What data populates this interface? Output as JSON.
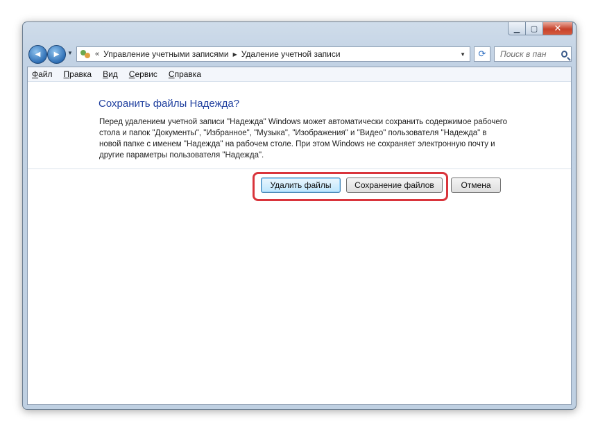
{
  "window": {
    "caption_buttons": {
      "minimize": "▁",
      "maximize": "▢",
      "close": "✕"
    }
  },
  "navbar": {
    "back_glyph": "◀",
    "forward_glyph": "▶",
    "history_glyph": "▼",
    "address": {
      "sep": "«",
      "crumbs": [
        "Управление учетными записями",
        "Удаление учетной записи"
      ],
      "crumb_arrow": "▶",
      "dropdown_glyph": "▼"
    },
    "refresh_glyph": "⟳",
    "search": {
      "placeholder": "Поиск в пан"
    }
  },
  "menubar": {
    "items": [
      {
        "accel": "Ф",
        "rest": "айл"
      },
      {
        "accel": "П",
        "rest": "равка"
      },
      {
        "accel": "В",
        "rest": "ид"
      },
      {
        "accel": "С",
        "rest": "ервис"
      },
      {
        "accel": "С",
        "rest": "правка"
      }
    ]
  },
  "main": {
    "heading": "Сохранить файлы Надежда?",
    "description": "Перед удалением учетной записи \"Надежда\" Windows может автоматически сохранить содержимое рабочего стола и папок \"Документы\", \"Избранное\", \"Музыка\", \"Изображения\" и \"Видео\" пользователя \"Надежда\" в новой папке с именем \"Надежда\" на рабочем столе. При этом Windows не сохраняет электронную почту и другие параметры пользователя \"Надежда\"."
  },
  "buttons": {
    "delete_files": "Удалить файлы",
    "keep_files": "Сохранение файлов",
    "cancel": "Отмена"
  },
  "colors": {
    "heading": "#1e3e9e",
    "highlight": "#d9343b"
  }
}
